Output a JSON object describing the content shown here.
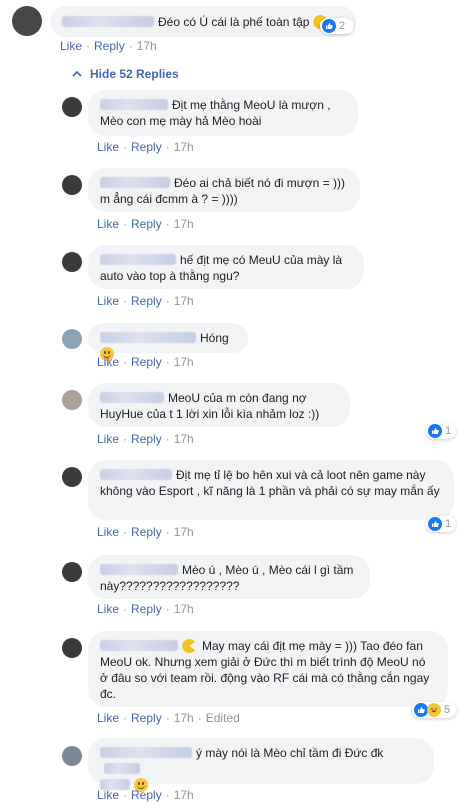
{
  "top_comment": {
    "author": "",
    "text": "Đéo có Ú cái là phế toàn tập",
    "actions": {
      "like": "Like",
      "reply": "Reply",
      "time": "17h"
    },
    "reaction_count": "2"
  },
  "hide_replies": "Hide 52 Replies",
  "replies": [
    {
      "text": "Địt mẹ thằng MeoU là mượn , Mèo con mẹ mày hả Mèo hoài",
      "like": "Like",
      "reply": "Reply",
      "time": "17h"
    },
    {
      "text": "Đéo ai chả biết nó đi mượn = ))) m ẳng cái đcmm à ? = ))))",
      "like": "Like",
      "reply": "Reply",
      "time": "17h"
    },
    {
      "text": "hế địt mẹ có MeuU của mày là auto vào top à thằng ngu?",
      "like": "Like",
      "reply": "Reply",
      "time": "17h"
    },
    {
      "text": "Hóng",
      "like": "Like",
      "reply": "Reply",
      "time": "17h"
    },
    {
      "text": "MeoU của m còn đang nợ HuyHue của t 1 lời xin lỗi kìa nhảm loz :))",
      "like": "Like",
      "reply": "Reply",
      "time": "17h",
      "reaction_count": "1"
    },
    {
      "text": "Địt mẹ tỉ lệ bo hên xui và cả loot nên game này không vào Esport , kĩ năng là 1 phần và phải có sự may mắn ấy",
      "like": "Like",
      "reply": "Reply",
      "time": "17h",
      "reaction_count": "1"
    },
    {
      "text": "Mèo ú , Mèo ú , Mèo cái l gì tầm này??????????????????",
      "like": "Like",
      "reply": "Reply",
      "time": "17h"
    },
    {
      "text": "May may cái địt mẹ mày = ))) Tao đéo fan MeoU ok. Nhưng xem giải ở Đức thì m biết trình độ MeoU nó ở đâu so với team rồi. động vào RF cái mà có thằng cắn ngay đc.",
      "like": "Like",
      "reply": "Reply",
      "time": "17h",
      "edited": "Edited",
      "reaction_count": "5"
    },
    {
      "text": "ý mày nói là Mèo chỉ tầm đi Đức đk",
      "like": "Like",
      "reply": "Reply",
      "time": "17h"
    }
  ],
  "colors": {
    "link": "#4267b2",
    "bubble": "#f2f3f5",
    "meta": "#90949c",
    "like_blue": "#1877f2"
  },
  "icons": {
    "like": "thumbs-up-icon",
    "haha": "laughing-emoji-icon",
    "smile": "smile-emoji-icon",
    "pacman": "pacman-emoji-icon"
  }
}
